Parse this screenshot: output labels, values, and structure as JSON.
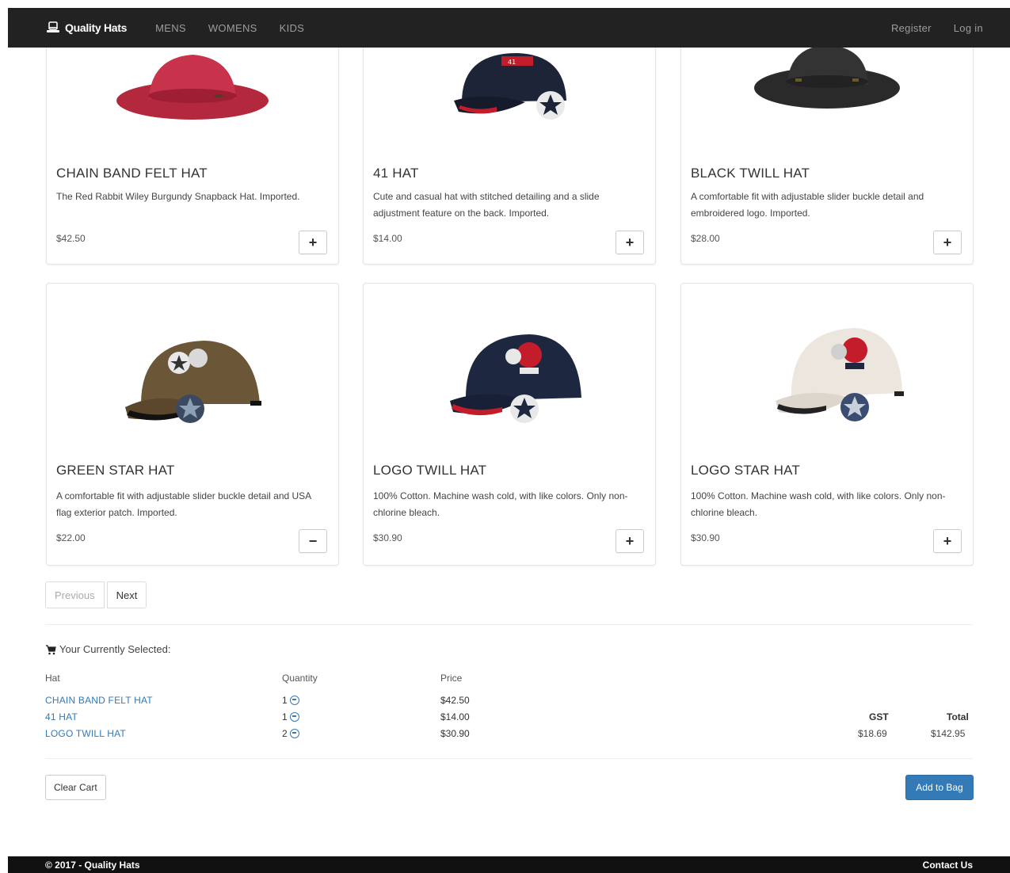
{
  "nav": {
    "brand": "Quality Hats",
    "brand_icon": "hat-icon",
    "links": [
      "MENS",
      "WOMENS",
      "KIDS"
    ],
    "register": "Register",
    "login": "Log in"
  },
  "products": [
    {
      "title": "CHAIN BAND FELT HAT",
      "desc": "The Red Rabbit Wiley Burgundy Snapback Hat. Imported.",
      "price": "$42.50",
      "hat": "red-bucket-hat",
      "add_icon": "plus-icon",
      "add_label": "+"
    },
    {
      "title": "41 HAT",
      "desc": "Cute and casual hat with stitched detailing and a slide adjustment feature on the back. Imported.",
      "price": "$14.00",
      "hat": "navy-cap",
      "add_icon": "plus-icon",
      "add_label": "+"
    },
    {
      "title": "BLACK TWILL HAT",
      "desc": "A comfortable fit with adjustable slider buckle detail and embroidered logo. Imported.",
      "price": "$28.00",
      "hat": "black-bucket-hat",
      "add_icon": "plus-icon",
      "add_label": "+"
    },
    {
      "title": "GREEN STAR HAT",
      "desc": "A comfortable fit with adjustable slider buckle detail and USA flag exterior patch. Imported.",
      "price": "$22.00",
      "hat": "green-star-cap",
      "add_icon": "minus-icon",
      "add_label": "−"
    },
    {
      "title": "LOGO TWILL HAT",
      "desc": "100% Cotton. Machine wash cold, with like colors. Only non-chlorine bleach.",
      "price": "$30.90",
      "hat": "navy-logo-cap",
      "add_icon": "plus-icon",
      "add_label": "+"
    },
    {
      "title": "LOGO STAR HAT",
      "desc": "100% Cotton. Machine wash cold, with like colors. Only non-chlorine bleach.",
      "price": "$30.90",
      "hat": "white-logo-cap",
      "add_icon": "plus-icon",
      "add_label": "+"
    }
  ],
  "pager": {
    "previous": "Previous",
    "next": "Next"
  },
  "cart": {
    "heading": "Your Currently Selected:",
    "heading_icon": "cart-icon",
    "col_hat": "Hat",
    "col_qty": "Quantity",
    "col_price": "Price",
    "items": [
      {
        "name": "CHAIN BAND FELT HAT",
        "qty": "1",
        "price": "$42.50"
      },
      {
        "name": "41 HAT",
        "qty": "1",
        "price": "$14.00"
      },
      {
        "name": "LOGO TWILL HAT",
        "qty": "2",
        "price": "$30.90"
      }
    ],
    "gst_label": "GST",
    "gst_value": "$18.69",
    "total_label": "Total",
    "total_value": "$142.95",
    "clear": "Clear Cart",
    "add_to_bag": "Add to Bag"
  },
  "footer": {
    "copyright": "© 2017 - Quality Hats",
    "contact": "Contact Us"
  },
  "colors": {
    "navbar": "#222222",
    "link": "#337ab7",
    "primary": "#337ab7",
    "footer": "#111111"
  }
}
